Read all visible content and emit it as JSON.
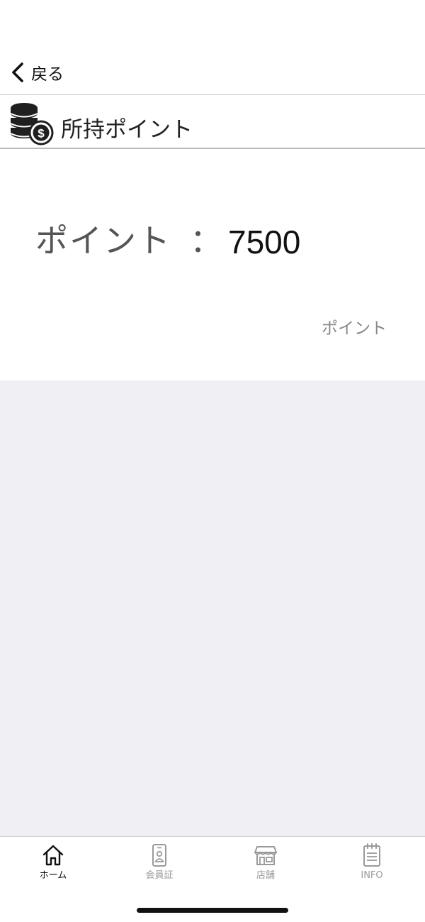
{
  "nav": {
    "back_label": "戻る"
  },
  "section": {
    "title": "所持ポイント",
    "icon": "coins-dollar-icon"
  },
  "points": {
    "label": "ポイント",
    "separator": "：",
    "value": "7500",
    "unit": "ポイント"
  },
  "tabs": [
    {
      "label": "ホーム",
      "icon": "home-icon",
      "active": true
    },
    {
      "label": "会員証",
      "icon": "member-card-icon",
      "active": false
    },
    {
      "label": "店舗",
      "icon": "store-icon",
      "active": false
    },
    {
      "label": "INFO",
      "icon": "notepad-icon",
      "active": false
    }
  ],
  "colors": {
    "background": "#ffffff",
    "content_background": "#efeff4",
    "active_tab": "#111111",
    "inactive_tab": "#9a9a9a",
    "divider": "#c8c8c8"
  }
}
